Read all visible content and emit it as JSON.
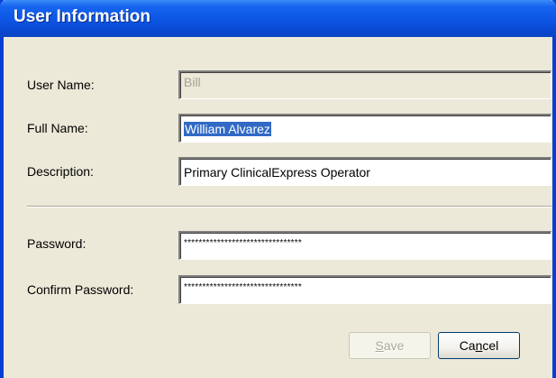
{
  "window": {
    "title": "User Information"
  },
  "form": {
    "user_name": {
      "label": "User Name:",
      "value": "Bill"
    },
    "full_name": {
      "label": "Full Name:",
      "value": "William Alvarez"
    },
    "description": {
      "label": "Description:",
      "value": "Primary ClinicalExpress Operator"
    },
    "password": {
      "label": "Password:",
      "value": "********************************"
    },
    "confirm_password": {
      "label": "Confirm Password:",
      "value": "********************************"
    }
  },
  "buttons": {
    "save": {
      "mnemonic": "S",
      "rest": "ave"
    },
    "cancel": {
      "pre": "Ca",
      "mnemonic": "n",
      "rest": "cel"
    }
  },
  "colors": {
    "title_bar": "#0a47cf",
    "selection": "#316ac5",
    "dialog_background": "#ece9d8"
  }
}
